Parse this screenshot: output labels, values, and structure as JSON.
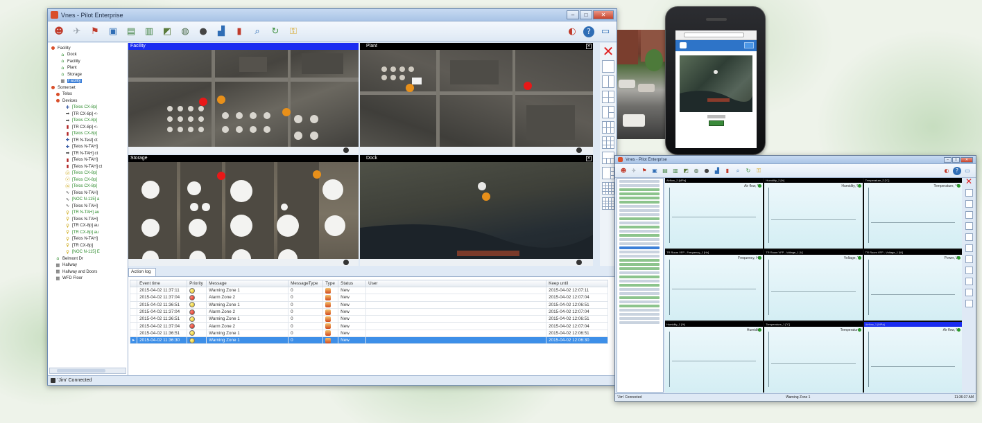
{
  "main_window": {
    "title": "Vnes - Pilot Enterprise",
    "buttons": {
      "minimize": "–",
      "maximize": "□",
      "close": "✕"
    },
    "toolbar_icons": [
      "users-icon",
      "plane-icon",
      "alarm-bell-icon",
      "monitor-icon",
      "book-icon",
      "report-icon",
      "map-icon",
      "globe-icon",
      "bomb-icon",
      "chart-icon",
      "fire-extinguisher-icon",
      "search-icon",
      "refresh-icon",
      "lock-icon"
    ],
    "tree": [
      {
        "label": "Facility",
        "indent": 0,
        "icon": "●",
        "color": "#d94f2a",
        "green": false
      },
      {
        "label": "Dock",
        "indent": 2,
        "icon": "⌂",
        "color": "#2a8a2a",
        "green": false
      },
      {
        "label": "Facility",
        "indent": 2,
        "icon": "⌂",
        "color": "#2a8a2a",
        "green": false
      },
      {
        "label": "Plant",
        "indent": 2,
        "icon": "⌂",
        "color": "#2a8a2a",
        "green": false
      },
      {
        "label": "Storage",
        "indent": 2,
        "icon": "⌂",
        "color": "#2a8a2a",
        "green": false
      },
      {
        "label": "Facility",
        "indent": 2,
        "icon": "▦",
        "color": "#555",
        "green": false,
        "selected": true
      },
      {
        "label": "Somerset",
        "indent": 0,
        "icon": "●",
        "color": "#d94f2a",
        "green": false
      },
      {
        "label": "Telos",
        "indent": 1,
        "icon": "●",
        "color": "#d94f2a",
        "green": false
      },
      {
        "label": "Devices",
        "indent": 1,
        "icon": "●",
        "color": "#d94f2a",
        "green": false
      },
      {
        "label": "[Telos CX-8p]",
        "indent": 3,
        "icon": "✚",
        "color": "#3b5fa8",
        "green": true
      },
      {
        "label": "[TR CX-8p] <-",
        "indent": 3,
        "icon": "➡",
        "color": "#333",
        "green": false
      },
      {
        "label": "[Telos CX-8p]",
        "indent": 3,
        "icon": "➡",
        "color": "#333",
        "green": true
      },
      {
        "label": "[TR CX-8p] <-",
        "indent": 3,
        "icon": "▮",
        "color": "#b02020",
        "green": false
      },
      {
        "label": "[Telos CX-8p]",
        "indent": 3,
        "icon": "▮",
        "color": "#b02020",
        "green": true
      },
      {
        "label": "[TR N-Test] ct",
        "indent": 3,
        "icon": "✚",
        "color": "#3b5fa8",
        "green": false
      },
      {
        "label": "[Telos N-TAH]",
        "indent": 3,
        "icon": "✚",
        "color": "#3b5fa8",
        "green": false
      },
      {
        "label": "[TR N-TAH] ct",
        "indent": 3,
        "icon": "➡",
        "color": "#333",
        "green": false
      },
      {
        "label": "[Telos N-TAH]",
        "indent": 3,
        "icon": "▮",
        "color": "#b02020",
        "green": false
      },
      {
        "label": "[Telos N-TAH] ct",
        "indent": 3,
        "icon": "▮",
        "color": "#b02020",
        "green": false
      },
      {
        "label": "[Telos CX-8p]",
        "indent": 3,
        "icon": "ⓟ",
        "color": "#c8a000",
        "green": true
      },
      {
        "label": "[Telos CX-8p]",
        "indent": 3,
        "icon": "ⓥ",
        "color": "#c8a000",
        "green": true
      },
      {
        "label": "[Telos CX-8p]",
        "indent": 3,
        "icon": "ⓦ",
        "color": "#c8a000",
        "green": true
      },
      {
        "label": "[Telos N-TAH]",
        "indent": 3,
        "icon": "∿",
        "color": "#333",
        "green": false
      },
      {
        "label": "[NOC N-115] a",
        "indent": 3,
        "icon": "∿",
        "color": "#333",
        "green": true
      },
      {
        "label": "[Telos N-TAH]",
        "indent": 3,
        "icon": "∿",
        "color": "#333",
        "green": false
      },
      {
        "label": "[TR N-TAH] au",
        "indent": 3,
        "icon": "♀",
        "color": "#c8a000",
        "green": true
      },
      {
        "label": "[Telos N-TAH]",
        "indent": 3,
        "icon": "♀",
        "color": "#c8a000",
        "green": false
      },
      {
        "label": "[TR CX-8p] au",
        "indent": 3,
        "icon": "♀",
        "color": "#c8a000",
        "green": false
      },
      {
        "label": "[TR CX-8p] au",
        "indent": 3,
        "icon": "♀",
        "color": "#c8a000",
        "green": true
      },
      {
        "label": "[Telos N-TAH]",
        "indent": 3,
        "icon": "♀",
        "color": "#c8a000",
        "green": false
      },
      {
        "label": "[TR CX-8p]",
        "indent": 3,
        "icon": "♀",
        "color": "#c8a000",
        "green": false
      },
      {
        "label": "[NOC N-115] E",
        "indent": 3,
        "icon": "♀",
        "color": "#c8a000",
        "green": true
      },
      {
        "label": "Belmont Dr",
        "indent": 1,
        "icon": "⌂",
        "color": "#2a8a2a",
        "green": false
      },
      {
        "label": "Hallway",
        "indent": 1,
        "icon": "▦",
        "color": "#555",
        "green": false
      },
      {
        "label": "Hallway and Doors",
        "indent": 1,
        "icon": "▦",
        "color": "#555",
        "green": false
      },
      {
        "label": "WFD Floor",
        "indent": 1,
        "icon": "▦",
        "color": "#555",
        "green": false
      }
    ],
    "panes": [
      {
        "title": "Facility",
        "active": true
      },
      {
        "title": "Plant",
        "active": false
      },
      {
        "title": "Storage",
        "active": false
      },
      {
        "title": "Dock",
        "active": false
      }
    ],
    "action_log": {
      "tab": "Action log",
      "columns": [
        "Event time",
        "Priority",
        "Message",
        "MessageType",
        "Type",
        "Status",
        "User",
        "Keep until"
      ],
      "rows": [
        {
          "time": "2015-04-02 11:37:11",
          "priority": "yellow",
          "message": "Warning Zone 1",
          "mtype": "0",
          "status": "New",
          "user": "",
          "keep": "2015-04-02 12:07:11"
        },
        {
          "time": "2015-04-02 11:37:04",
          "priority": "red",
          "message": "Alarm Zone 2",
          "mtype": "0",
          "status": "New",
          "user": "",
          "keep": "2015-04-02 12:07:04"
        },
        {
          "time": "2015-04-02 11:36:51",
          "priority": "yellow",
          "message": "Warning Zone 1",
          "mtype": "0",
          "status": "New",
          "user": "",
          "keep": "2015-04-02 12:06:51"
        },
        {
          "time": "2015-04-02 11:37:04",
          "priority": "red",
          "message": "Alarm Zone 2",
          "mtype": "0",
          "status": "New",
          "user": "",
          "keep": "2015-04-02 12:07:04"
        },
        {
          "time": "2015-04-02 11:36:51",
          "priority": "yellow",
          "message": "Warning Zone 1",
          "mtype": "0",
          "status": "New",
          "user": "",
          "keep": "2015-04-02 12:06:51"
        },
        {
          "time": "2015-04-02 11:37:04",
          "priority": "red",
          "message": "Alarm Zone 2",
          "mtype": "0",
          "status": "New",
          "user": "",
          "keep": "2015-04-02 12:07:04"
        },
        {
          "time": "2015-04-02 11:36:51",
          "priority": "yellow",
          "message": "Warning Zone 1",
          "mtype": "0",
          "status": "New",
          "user": "",
          "keep": "2015-04-02 12:06:51"
        },
        {
          "time": "2015-04-02 11:36:30",
          "priority": "yellow",
          "message": "Warning Zone 1",
          "mtype": "0",
          "status": "New",
          "user": "",
          "keep": "2015-04-02 12:06:30",
          "selected": true
        }
      ]
    },
    "status": "'Jim' Connected"
  },
  "second_window": {
    "title": "Vnes - Pilot Enterprise",
    "cells": [
      {
        "head": "Airflow_2 [MPa]",
        "label": "Air flow, %",
        "active": false
      },
      {
        "head": "Humidity_2 [%]",
        "label": "Humidity, %",
        "active": false
      },
      {
        "head": "Temperature_2 [°C]",
        "label": "Temperature, °C",
        "active": false
      },
      {
        "head": "TR Room VFP - Frequency_1 [Hz]",
        "label": "Frequency, Hz",
        "active": false
      },
      {
        "head": "TR Room VFP - Voltage_1 [V]",
        "label": "Voltage, V",
        "active": false
      },
      {
        "head": "TR Room VFP - Voltage_1 [W]",
        "label": "Power, W",
        "active": false
      },
      {
        "head": "Humidity_1 [%]",
        "label": "Humidity",
        "active": false
      },
      {
        "head": "Temperature_1 [°C]",
        "label": "Temperature",
        "active": false
      },
      {
        "head": "Airflow_1 [MPa]",
        "label": "Air flow, %",
        "active": true
      }
    ],
    "status_left": "'Jim' Connected",
    "status_mid": "Warning Zone 1",
    "status_right": "11:36:37 AM"
  },
  "colors": {
    "alarm_red": "#e81818",
    "warning_orange": "#e8901a",
    "selection_blue": "#3d8fe8",
    "active_pane_blue": "#1a2cf0"
  }
}
